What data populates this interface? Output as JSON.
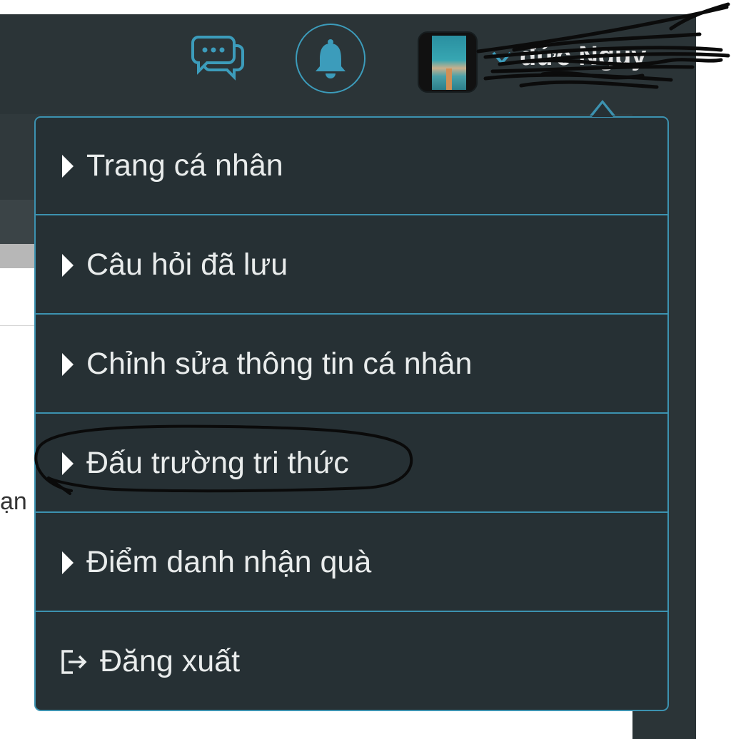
{
  "header": {
    "chat_icon": "chat-bubbles-icon",
    "bell_icon": "bell-icon",
    "username": "đức Nguy"
  },
  "background": {
    "partial_text": "ạn"
  },
  "menu": {
    "items": [
      {
        "label": "Trang cá nhân",
        "icon": "caret-right-icon"
      },
      {
        "label": "Câu hỏi đã lưu",
        "icon": "caret-right-icon"
      },
      {
        "label": "Chỉnh sửa thông tin cá nhân",
        "icon": "caret-right-icon"
      },
      {
        "label": "Đấu trường tri thức",
        "icon": "caret-right-icon"
      },
      {
        "label": "Điểm danh nhận quà",
        "icon": "caret-right-icon"
      },
      {
        "label": "Đăng xuất",
        "icon": "logout-icon"
      }
    ]
  },
  "colors": {
    "menu_bg": "#263034",
    "menu_border": "#3c92b0",
    "accent": "#3c9cbb",
    "header_bg": "#2b3437"
  }
}
